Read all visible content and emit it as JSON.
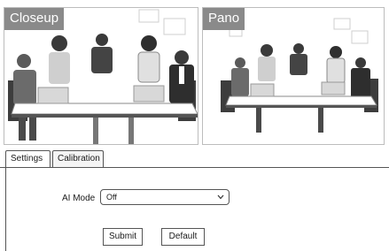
{
  "panes": {
    "left": {
      "label": "Closeup"
    },
    "right": {
      "label": "Pano"
    }
  },
  "tabs": [
    {
      "label": "Settings",
      "active": true
    },
    {
      "label": "Calibration",
      "active": false
    }
  ],
  "settings": {
    "ai_mode_label": "AI Mode",
    "ai_mode_value": "Off"
  },
  "buttons": {
    "submit": "Submit",
    "default": "Default"
  }
}
